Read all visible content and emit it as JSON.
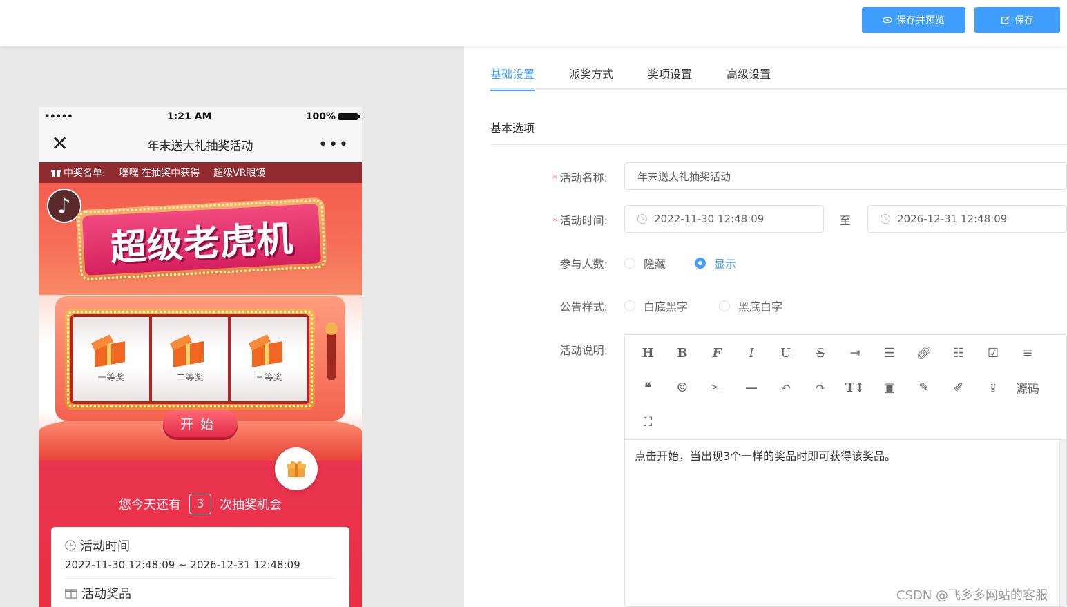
{
  "toolbar_top": {
    "preview_label": "保存并预览",
    "save_label": "保存"
  },
  "phone": {
    "time": "1:21 AM",
    "battery": "100%",
    "signal": "•••••",
    "title": "年末送大礼抽奖活动",
    "close_glyph": "✕",
    "more_glyph": "•••",
    "marquee": {
      "label": "中奖名单:",
      "winner": "嘿嘿",
      "text": "在抽奖中获得",
      "prize": "超级VR眼镜"
    },
    "hero_title": "超级老虎机",
    "reels": [
      "一等奖",
      "二等奖",
      "三等奖"
    ],
    "start_label": "开始",
    "chances_prefix": "您今天还有",
    "chances_count": "3",
    "chances_suffix": "次抽奖机会",
    "info_time_label": "活动时间",
    "info_time_value": "2022-11-30 12:48:09 ~ 2026-12-31 12:48:09",
    "info_prize_label": "活动奖品"
  },
  "tabs": [
    {
      "label": "基础设置",
      "active": true
    },
    {
      "label": "派奖方式",
      "active": false
    },
    {
      "label": "奖项设置",
      "active": false
    },
    {
      "label": "高级设置",
      "active": false
    }
  ],
  "section_title": "基本选项",
  "form": {
    "name_label": "活动名称:",
    "name_value": "年末送大礼抽奖活动",
    "time_label": "活动时间:",
    "time_start": "2022-11-30 12:48:09",
    "time_to": "至",
    "time_end": "2026-12-31 12:48:09",
    "participants_label": "参与人数:",
    "participants_options": [
      "隐藏",
      "显示"
    ],
    "participants_selected": "显示",
    "notice_label": "公告样式:",
    "notice_options": [
      "白底黑字",
      "黑底白字"
    ],
    "desc_label": "活动说明:",
    "required_mark": "*"
  },
  "editor": {
    "toolbar": [
      "H",
      "B",
      "F",
      "I",
      "U",
      "S",
      "indent",
      "align",
      "link",
      "list",
      "check",
      "justify",
      "quote",
      "emoji",
      "code",
      "hr",
      "undo",
      "redo",
      "text-size",
      "image",
      "pen",
      "brush",
      "upload",
      "源码",
      "fullscreen"
    ],
    "source_label": "源码",
    "content": "点击开始，当出现3个一样的奖品时即可获得该奖品。"
  },
  "watermark": "CSDN @飞多多网站的客服",
  "colors": {
    "primary": "#409eff",
    "danger": "#f56c6c",
    "phone_red": "#e93041"
  }
}
